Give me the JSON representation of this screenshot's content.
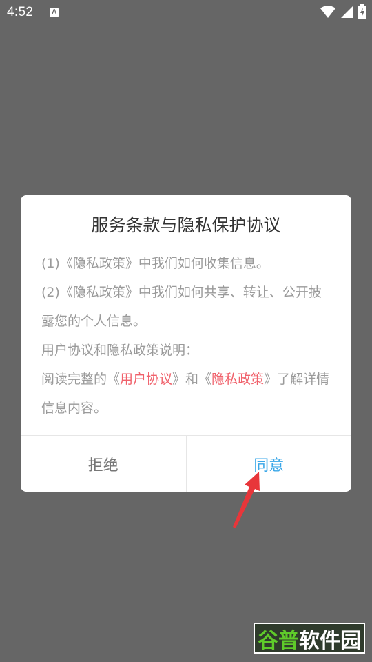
{
  "status_bar": {
    "time": "4:52",
    "notification_icon_letter": "A",
    "icons": [
      "wifi-icon",
      "signal-icon",
      "battery-charging-icon"
    ]
  },
  "dialog": {
    "title": "服务条款与隐私保护协议",
    "lines": {
      "p1": "(1)《隐私政策》中我们如何收集信息。",
      "p2": "(2)《隐私政策》中我们如何共享、转让、公开披露您的个人信息。",
      "p3": "用户协议和隐私政策说明：",
      "p4_pre": "阅读完整的《",
      "p4_link1": "用户协议",
      "p4_mid": "》和《",
      "p4_link2": "隐私政策",
      "p4_post": "》了解详情信息内容。"
    },
    "buttons": {
      "reject": "拒绝",
      "agree": "同意"
    },
    "colors": {
      "link": "#f0616b",
      "agree": "#3aa7e8"
    }
  },
  "annotation": {
    "arrow_color": "#e8363a"
  },
  "watermark": {
    "part1": "谷普",
    "part2": "软件园"
  }
}
